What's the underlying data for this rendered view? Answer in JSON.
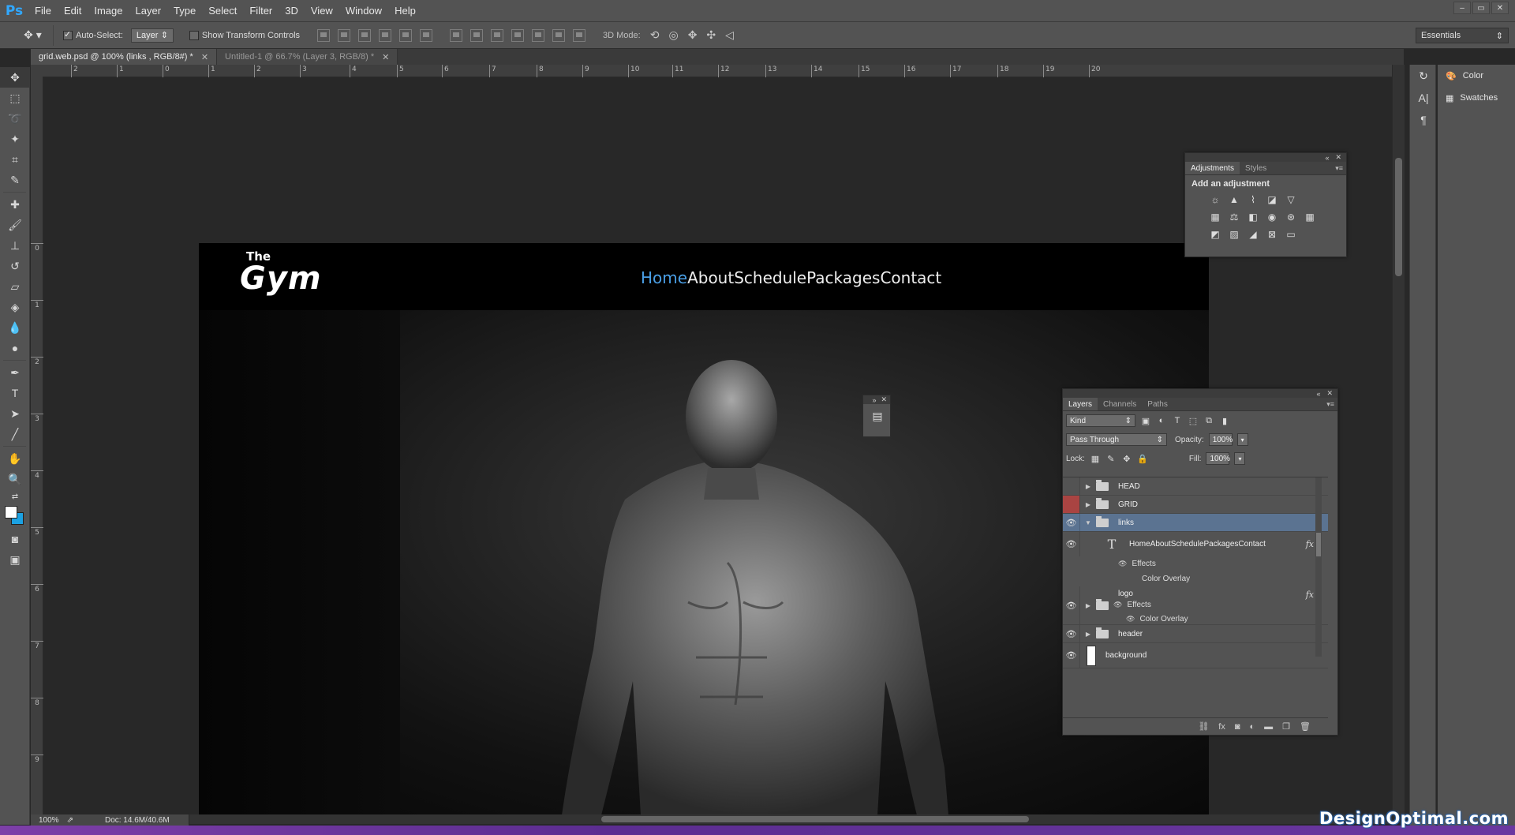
{
  "app": {
    "logo": "Ps"
  },
  "menu": [
    "File",
    "Edit",
    "Image",
    "Layer",
    "Type",
    "Select",
    "Filter",
    "3D",
    "View",
    "Window",
    "Help"
  ],
  "window_controls": [
    "–",
    "▭",
    "✕"
  ],
  "options": {
    "auto_select_label": "Auto-Select:",
    "auto_select_checked": true,
    "auto_select_value": "Layer",
    "transform_label": "Show Transform Controls",
    "mode3d_label": "3D Mode:",
    "workspace": "Essentials"
  },
  "tabs": [
    {
      "label": "grid.web.psd @ 100% (links , RGB/8#) *",
      "active": true
    },
    {
      "label": "Untitled-1 @ 66.7% (Layer 3, RGB/8) *",
      "active": false
    }
  ],
  "ruler_h": [
    "2",
    "1",
    "0",
    "1",
    "2",
    "3",
    "4",
    "5",
    "6",
    "7",
    "8",
    "9",
    "10",
    "11",
    "12",
    "13",
    "14",
    "15",
    "16",
    "17",
    "18",
    "19",
    "20"
  ],
  "ruler_v": [
    "0",
    "1",
    "2",
    "3",
    "4",
    "5",
    "6",
    "7",
    "8",
    "9"
  ],
  "canvas": {
    "logo_small": "The",
    "logo_big": "Gym",
    "nav": [
      "Home",
      "About",
      "Schedule",
      "Packages",
      "Contact"
    ],
    "nav_active_color": "#4a9fe6"
  },
  "status": {
    "zoom": "100%",
    "doc": "Doc: 14.6M/40.6M"
  },
  "right_panels": [
    "Color",
    "Swatches"
  ],
  "adjustments": {
    "tabs": [
      "Adjustments",
      "Styles"
    ],
    "title": "Add an adjustment"
  },
  "layers": {
    "tabs": [
      "Layers",
      "Channels",
      "Paths"
    ],
    "kind": "Kind",
    "blend_mode": "Pass Through",
    "opacity_label": "Opacity:",
    "opacity": "100%",
    "lock_label": "Lock:",
    "fill_label": "Fill:",
    "fill": "100%",
    "items": {
      "head": "HEAD",
      "grid": "GRID",
      "links": "links",
      "text_layer": "HomeAboutSchedulePackagesContact",
      "effects": "Effects",
      "color_overlay": "Color Overlay",
      "logo": "logo",
      "header": "header",
      "background": "background"
    },
    "fx_label": "fx"
  },
  "watermark": "DesignOptimal.com"
}
